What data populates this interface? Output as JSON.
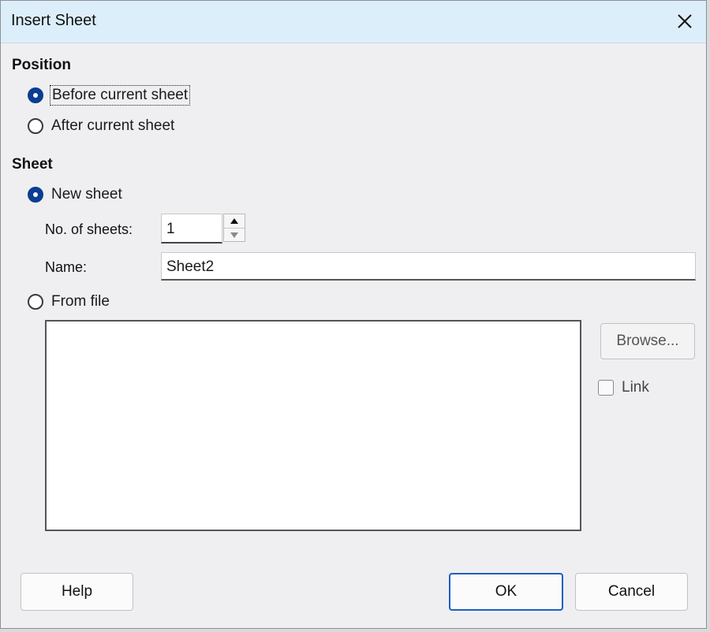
{
  "window": {
    "title": "Insert Sheet"
  },
  "position": {
    "label": "Position",
    "options": [
      {
        "label": "Before current sheet",
        "checked": true
      },
      {
        "label": "After current sheet",
        "checked": false
      }
    ]
  },
  "sheet": {
    "label": "Sheet",
    "new_sheet_label": "New sheet",
    "new_sheet_checked": true,
    "count_label": "No. of sheets:",
    "count_value": "1",
    "name_label": "Name:",
    "name_value": "Sheet2",
    "from_file_label": "From file",
    "from_file_checked": false,
    "browse_label": "Browse...",
    "link_label": "Link",
    "link_checked": false
  },
  "footer": {
    "help_label": "Help",
    "ok_label": "OK",
    "cancel_label": "Cancel"
  },
  "colors": {
    "titlebar": "#dceefa",
    "accent": "#0b3d91",
    "default_button_border": "#1d5fbf"
  }
}
